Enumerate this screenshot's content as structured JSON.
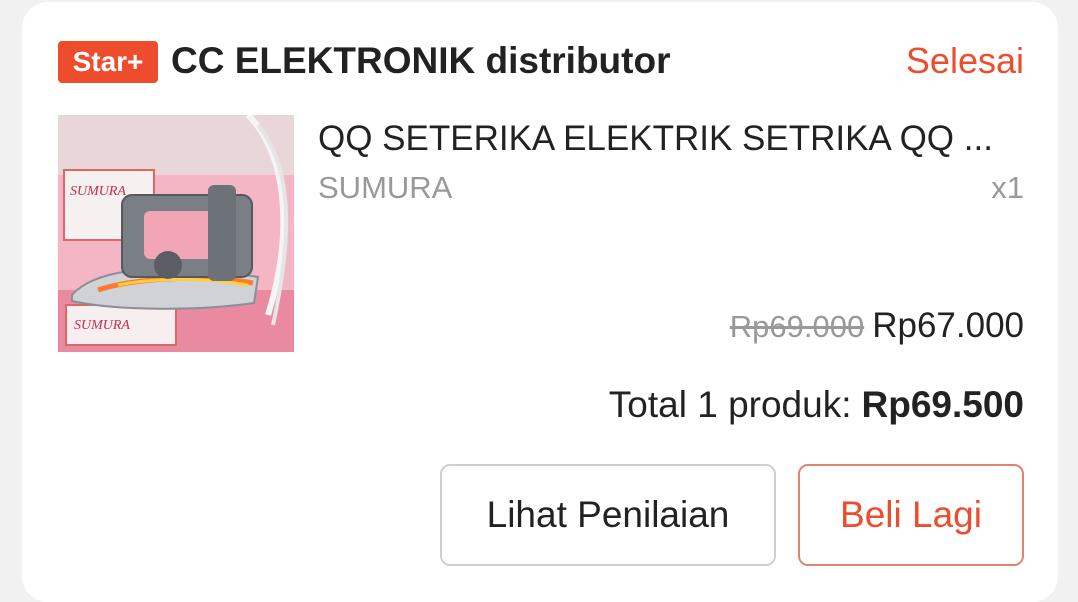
{
  "shop": {
    "badge": "Star+",
    "name": "CC ELEKTRONIK distributor",
    "status": "Selesai"
  },
  "product": {
    "name": "QQ SETERIKA ELEKTRIK SETRIKA QQ ...",
    "variant": "SUMURA",
    "quantity": "x1",
    "original_price": "Rp69.000",
    "price": "Rp67.000",
    "image_brand_text": "SUMURA"
  },
  "summary": {
    "total_label": "Total 1 produk:",
    "total_value": "Rp69.500"
  },
  "actions": {
    "review_label": "Lihat Penilaian",
    "buy_again_label": "Beli Lagi"
  },
  "colors": {
    "accent": "#ee4d2d",
    "muted_text": "#999999"
  }
}
